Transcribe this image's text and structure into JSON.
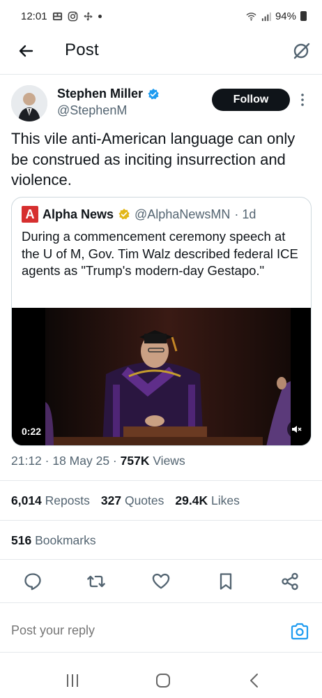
{
  "status_bar": {
    "time": "12:01",
    "battery": "94%",
    "icons": [
      "gallery-icon",
      "instagram-icon",
      "fan-icon",
      "notification-dot",
      "wifi-icon",
      "signal-icon",
      "battery-icon"
    ]
  },
  "header": {
    "title": "Post",
    "back_icon": "arrow-left-icon",
    "grok_icon": "grok-icon"
  },
  "post": {
    "author_name": "Stephen Miller",
    "author_handle": "@StephenM",
    "verified_icon": "verified-badge-icon",
    "follow_label": "Follow",
    "text": "This vile anti-American language can only be construed as inciting insurrection and violence.",
    "quote": {
      "logo_letter": "A",
      "name": "Alpha News",
      "handle": "@AlphaNewsMN",
      "time": "· 1d",
      "text": "During a commencement ceremony speech at the U of M, Gov. Tim Walz described federal ICE agents as \"Trump's modern-day Gestapo.\"",
      "video_duration": "0:22"
    },
    "timestamp": "21:12 · 18 May 25 · ",
    "views_count": "757K",
    "views_label": " Views",
    "stats": {
      "reposts_count": "6,014",
      "reposts_label": "Reposts",
      "quotes_count": "327",
      "quotes_label": "Quotes",
      "likes_count": "29.4K",
      "likes_label": "Likes",
      "bookmarks_count": "516",
      "bookmarks_label": "Bookmarks"
    }
  },
  "actions": [
    "reply-icon",
    "repost-icon",
    "like-icon",
    "bookmark-icon",
    "share-icon"
  ],
  "reply": {
    "placeholder": "Post your reply"
  },
  "colors": {
    "text": "#0f1419",
    "muted": "#536471",
    "accent": "#1d9bf0",
    "gold_badge": "#e2b719",
    "divider": "#e4e8eb"
  }
}
